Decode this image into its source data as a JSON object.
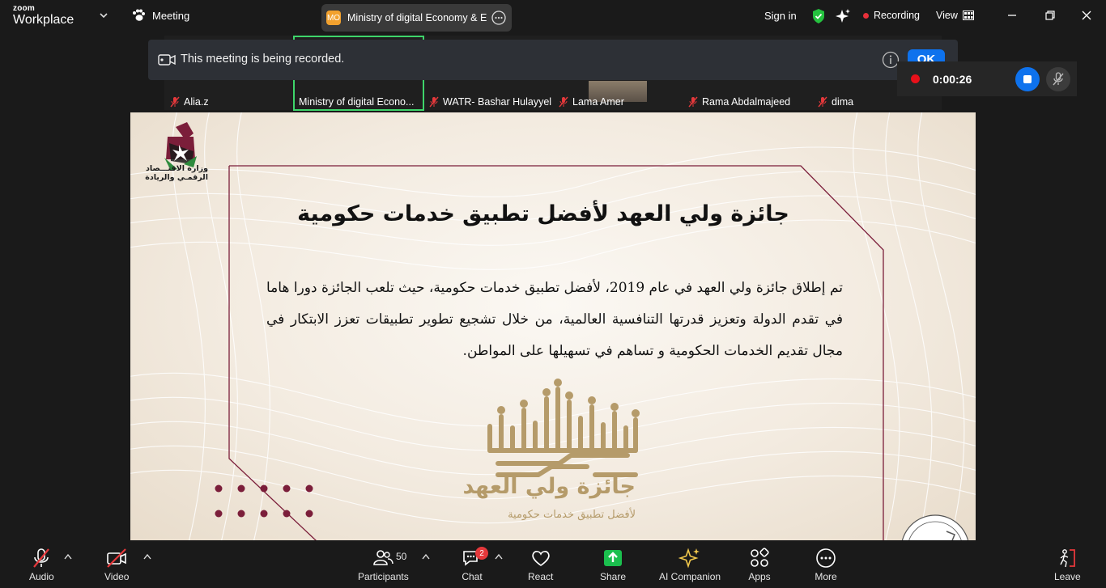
{
  "app": {
    "brand_top": "zoom",
    "brand_bottom": "Workplace"
  },
  "topbar": {
    "meeting_label": "Meeting",
    "tab_badge": "MO",
    "tab_title": "Ministry of digital Economy & Er",
    "signin": "Sign in",
    "recording": "Recording",
    "view": "View"
  },
  "participants_strip": [
    {
      "name": "Alia.z"
    },
    {
      "name": "Ministry of digital Econo..."
    },
    {
      "name": "WATR- Bashar Hulayyel"
    },
    {
      "name": "Lama Amer"
    },
    {
      "name": "Rama Abdalmajeed"
    },
    {
      "name": "dima"
    }
  ],
  "banner": {
    "message": "This meeting is being recorded.",
    "ok": "OK"
  },
  "recording_timer": {
    "time": "0:00:26"
  },
  "slide": {
    "ministry_name_line1": "وزارة الاقتـــصاد",
    "ministry_name_line2": "الرقمـي والريادة",
    "title": "جائزة ولي العهد لأفضل تطبيق خدمات حكومية",
    "body": "تم إطلاق جائزة ولي العهد في عام 2019، لأفضل تطبيق خدمات حكومية، حيث تلعب الجائزة دورا هاما في تقدم الدولة وتعزيز قدرتها التنافسية العالمية، من خلال تشجيع تطوير تطبيقات تعزز الابتكار في مجال تقديم الخدمات الحكومية و تساهم في تسهيلها على المواطن.",
    "award_name": "جائزة ولي العهد",
    "award_subtitle": "لأفضل تطبيق خدمات حكومية",
    "accent_color": "#7b1e3a",
    "gold_color": "#b59b6a"
  },
  "toolbar": {
    "audio": "Audio",
    "video": "Video",
    "participants": "Participants",
    "participants_count": "50",
    "chat": "Chat",
    "chat_badge": "2",
    "react": "React",
    "share": "Share",
    "ai_companion": "AI Companion",
    "apps": "Apps",
    "more": "More",
    "leave": "Leave"
  },
  "colors": {
    "share_green": "#1bbf4e",
    "zoom_blue": "#0e72ed",
    "record_red": "#e8101a",
    "active_border": "#3ed56a"
  }
}
